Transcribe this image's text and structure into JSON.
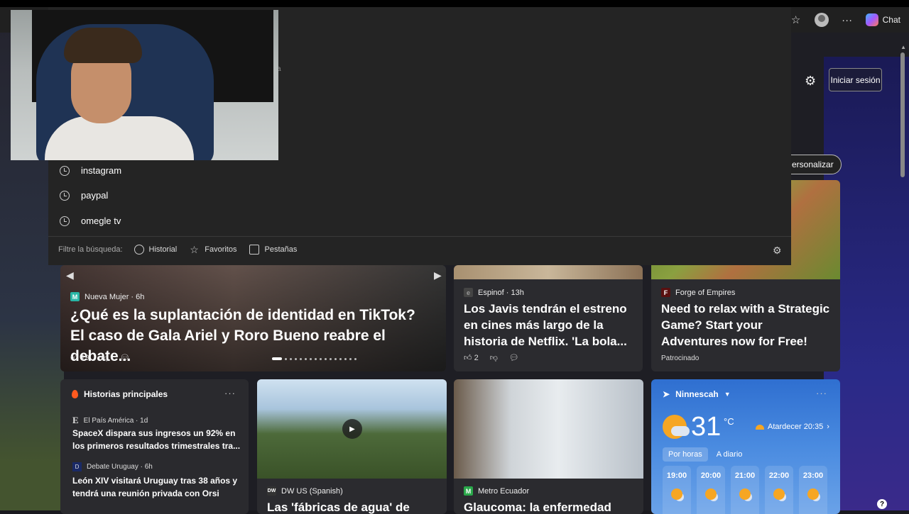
{
  "browser": {
    "chat_label": "Chat",
    "more_label": "···",
    "favorite_glyph": "☆"
  },
  "header": {
    "signin_label": "Iniciar sesión",
    "personalize_label": "ersonalizar",
    "gear_glyph": "⚙"
  },
  "search_dropdown": {
    "suggestions": [
      {
        "label": "instagram",
        "icon": "history-icon"
      },
      {
        "label": "paypal",
        "icon": "history-icon"
      },
      {
        "label": "omegle tv",
        "icon": "history-icon"
      }
    ],
    "filter_label": "Filtre la búsqueda:",
    "filters": [
      {
        "label": "Historial",
        "icon": "history-icon"
      },
      {
        "label": "Favoritos",
        "icon": "star-icon"
      },
      {
        "label": "Pestañas",
        "icon": "tabs-icon"
      }
    ],
    "webcam_fragment": "a"
  },
  "hero": {
    "source": "Nueva Mujer · 6h",
    "source_logo": "M",
    "title": "¿Qué es la suplantación de identidad en TikTok? El caso de Gala Ariel y Roro Bueno reabre el debate...",
    "likes": "19",
    "prev_glyph": "◀",
    "next_glyph": "▶"
  },
  "card_espinof": {
    "source": "Espinof · 13h",
    "source_logo": "e",
    "title": "Los Javis tendrán el estreno en cines más largo de la historia de Netflix. 'La bola...",
    "likes": "2"
  },
  "card_forge": {
    "source": "Forge of Empires",
    "source_logo": "F",
    "title": "Need to relax with a Strategic Game? Start your Adventures now for Free!",
    "sponsored": "Patrocinado"
  },
  "top_stories": {
    "heading": "Historias principales",
    "more": "···",
    "items": [
      {
        "source": "El País América · 1d",
        "logo": "E",
        "title": "SpaceX dispara sus ingresos un 92% en los primeros resultados trimestrales tra..."
      },
      {
        "source": "Debate Uruguay · 6h",
        "logo": "D",
        "title": "León XIV visitará Uruguay tras 38 años y tendrá una reunión privada con Orsi"
      }
    ]
  },
  "card_dw": {
    "source": "DW US (Spanish)",
    "source_logo": "DW",
    "title": "Las 'fábricas de agua' de"
  },
  "card_metro": {
    "source": "Metro Ecuador",
    "source_logo": "M",
    "title": "Glaucoma: la enfermedad"
  },
  "weather": {
    "location": "Ninnescah",
    "temp": "31",
    "unit": "°C",
    "sunset": "Atardecer 20:35",
    "tabs": [
      "Por horas",
      "A diario"
    ],
    "hours": [
      "19:00",
      "20:00",
      "21:00",
      "22:00",
      "23:00"
    ],
    "more": "···"
  },
  "help_label": "?"
}
